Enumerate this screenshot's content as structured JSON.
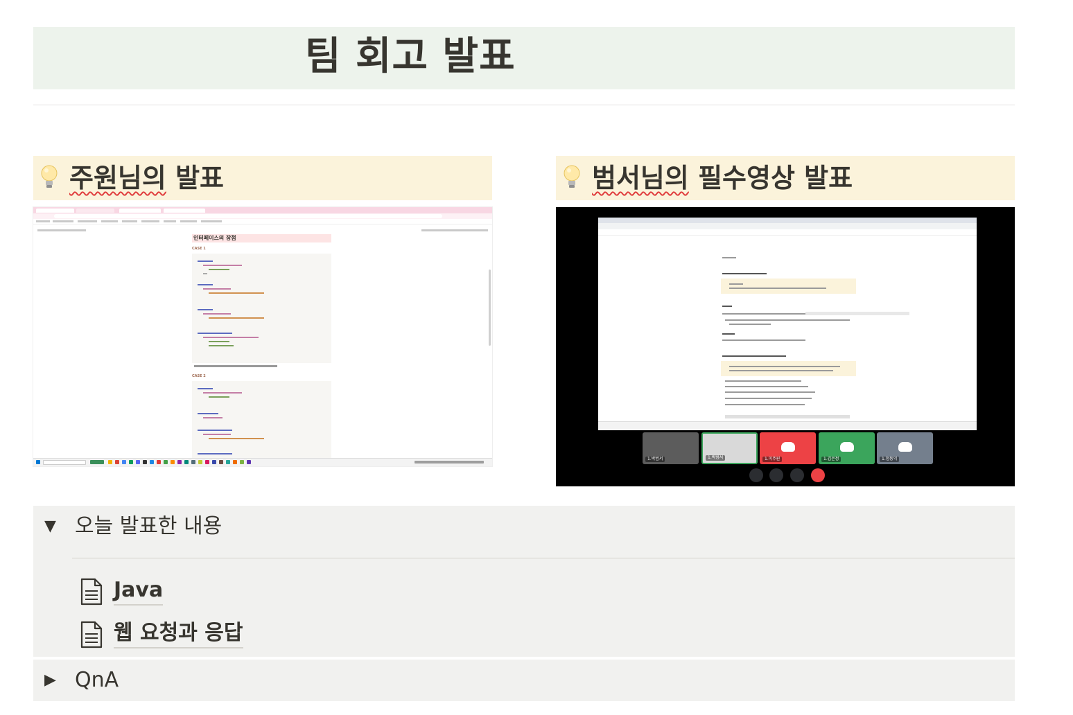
{
  "page": {
    "title": "팀 회고 발표"
  },
  "callouts": [
    {
      "icon": "lightbulb-icon",
      "name_prefix": "주원님의",
      "name_suffix": " 발표"
    },
    {
      "icon": "lightbulb-icon",
      "name_prefix": "범서님의",
      "name_suffix": " 필수영상 발표"
    }
  ],
  "screenshot1": {
    "page_title": "인터페이스의 장점",
    "case1": "CASE 1",
    "case2": "CASE 2"
  },
  "screenshot2": {
    "participants": [
      "1.박범서",
      "1.박범서",
      "1.이주원",
      "1.김은정",
      "1.정동익"
    ]
  },
  "toggles": [
    {
      "arrow": "▼",
      "label": "오늘 발표한 내용",
      "expanded": true,
      "pages": [
        {
          "icon": "page-document-icon",
          "title": "Java"
        },
        {
          "icon": "page-document-icon",
          "title": "웹 요청과 응답"
        }
      ]
    },
    {
      "arrow": "▶",
      "label": "QnA",
      "expanded": false
    }
  ],
  "colors": {
    "title_bg": "#edf3ec",
    "callout_bg": "#fbf3db",
    "toggle_bg": "#f1f1ef",
    "text": "#37352f",
    "spell_underline": "#e03e3e"
  }
}
